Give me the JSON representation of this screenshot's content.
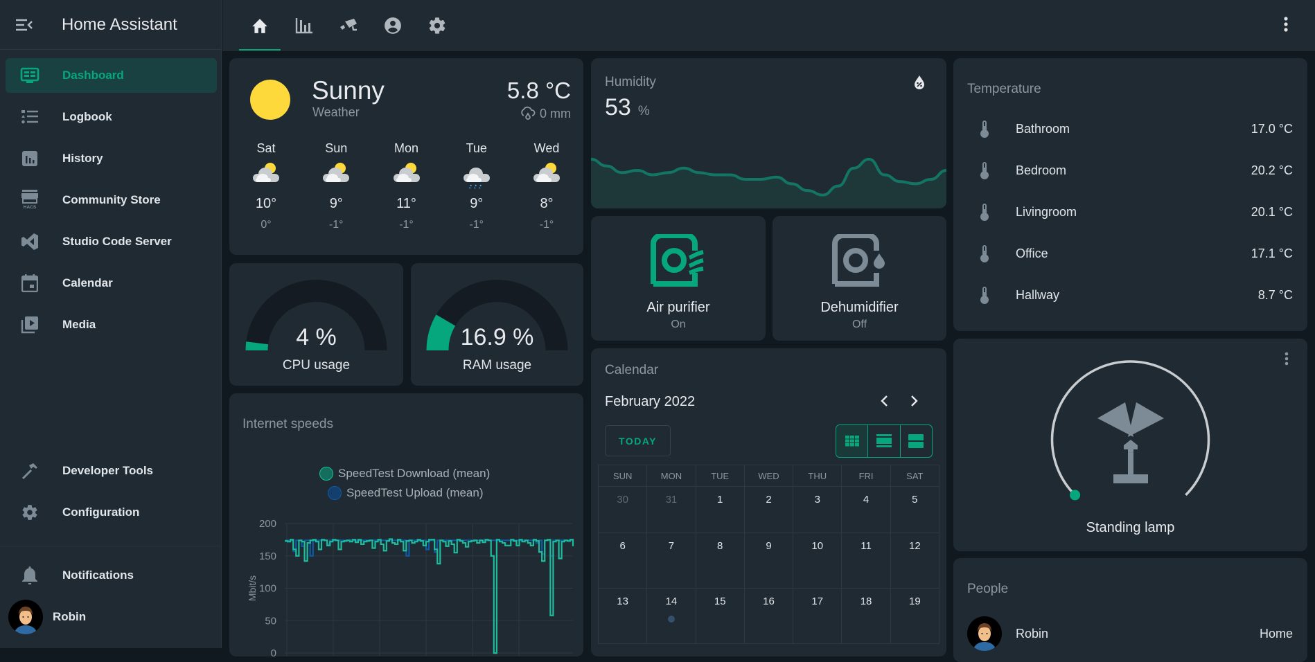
{
  "app": {
    "title": "Home Assistant"
  },
  "sidebar": {
    "items": [
      {
        "label": "Dashboard",
        "icon": "dashboard-icon",
        "active": true
      },
      {
        "label": "Logbook",
        "icon": "logbook-icon"
      },
      {
        "label": "History",
        "icon": "history-icon"
      },
      {
        "label": "Community Store",
        "icon": "hacs-icon"
      },
      {
        "label": "Studio Code Server",
        "icon": "vscode-icon"
      },
      {
        "label": "Calendar",
        "icon": "calendar-icon"
      },
      {
        "label": "Media",
        "icon": "media-icon"
      }
    ],
    "bottom": [
      {
        "label": "Developer Tools",
        "icon": "hammer-icon"
      },
      {
        "label": "Configuration",
        "icon": "gear-icon"
      }
    ],
    "notifications": "Notifications",
    "user": "Robin"
  },
  "topbar": {
    "tabs": [
      "home",
      "energy",
      "camera",
      "person",
      "settings"
    ],
    "active_tab": "home"
  },
  "weather": {
    "condition": "Sunny",
    "name": "Weather",
    "temperature": "5.8 °C",
    "precipitation": "0 mm",
    "forecast": [
      {
        "day": "Sat",
        "high": "10°",
        "low": "0°",
        "icon": "partly-cloudy"
      },
      {
        "day": "Sun",
        "high": "9°",
        "low": "-1°",
        "icon": "partly-cloudy"
      },
      {
        "day": "Mon",
        "high": "11°",
        "low": "-1°",
        "icon": "partly-cloudy"
      },
      {
        "day": "Tue",
        "high": "9°",
        "low": "-1°",
        "icon": "rainy"
      },
      {
        "day": "Wed",
        "high": "8°",
        "low": "-1°",
        "icon": "partly-cloudy"
      }
    ]
  },
  "gauges": [
    {
      "label": "CPU usage",
      "display": "4 %",
      "value": 4
    },
    {
      "label": "RAM usage",
      "display": "16.9 %",
      "value": 16.9
    }
  ],
  "humidity": {
    "title": "Humidity",
    "value": "53",
    "unit": "%",
    "history": [
      62,
      59,
      56,
      57,
      55,
      56,
      58,
      56,
      55,
      55,
      53,
      53,
      54,
      51,
      48,
      46,
      50,
      58,
      62,
      55,
      52,
      51,
      53,
      57
    ]
  },
  "devices": [
    {
      "name": "Air purifier",
      "state": "On",
      "color": "#06a77d"
    },
    {
      "name": "Dehumidifier",
      "state": "Off",
      "color": "#7c8b96"
    }
  ],
  "temperature": {
    "title": "Temperature",
    "rows": [
      {
        "name": "Bathroom",
        "value": "17.0 °C"
      },
      {
        "name": "Bedroom",
        "value": "20.2 °C"
      },
      {
        "name": "Livingroom",
        "value": "20.1 °C"
      },
      {
        "name": "Office",
        "value": "17.1 °C"
      },
      {
        "name": "Hallway",
        "value": "8.7 °C"
      }
    ]
  },
  "lamp": {
    "name": "Standing lamp",
    "brightness": 0
  },
  "calendar": {
    "title": "Calendar",
    "month": "February 2022",
    "today_label": "TODAY",
    "weekdays": [
      "SUN",
      "MON",
      "TUE",
      "WED",
      "THU",
      "FRI",
      "SAT"
    ],
    "weeks": [
      [
        "30",
        "31",
        "1",
        "2",
        "3",
        "4",
        "5"
      ],
      [
        "6",
        "7",
        "8",
        "9",
        "10",
        "11",
        "12"
      ],
      [
        "13",
        "14",
        "15",
        "16",
        "17",
        "18",
        "19"
      ]
    ],
    "outside_month": [
      "30",
      "31"
    ],
    "event_days": [
      "14"
    ]
  },
  "people": {
    "title": "People",
    "rows": [
      {
        "name": "Robin",
        "state": "Home"
      }
    ]
  },
  "chart_data": {
    "type": "line",
    "title": "Internet speeds",
    "ylabel": "Mbit/s",
    "ylim": [
      0,
      200
    ],
    "yticks": [
      0,
      50,
      100,
      150,
      200
    ],
    "legend": "top",
    "series": [
      {
        "name": "SpeedTest Download (mean)",
        "color": "#1cbc9c",
        "values": [
          173,
          172,
          175,
          160,
          150,
          174,
          172,
          142,
          170,
          174,
          175,
          172,
          160,
          175,
          174,
          166,
          172,
          175,
          174,
          160,
          172,
          173,
          174,
          172,
          175,
          171,
          175,
          168,
          172,
          173,
          174,
          162,
          172,
          175,
          168,
          158,
          173,
          176,
          170,
          168,
          175,
          172,
          158,
          173,
          174,
          170,
          172,
          175,
          173,
          166,
          172,
          175,
          175,
          160,
          138,
          174,
          172,
          165,
          173,
          168,
          155,
          175,
          173,
          170,
          164,
          172,
          173,
          174,
          170,
          174,
          171,
          175,
          174,
          150,
          0,
          175,
          172,
          170,
          166,
          166,
          175,
          173,
          166,
          175,
          172,
          174,
          170,
          166,
          175,
          173,
          156,
          142,
          174,
          175,
          58,
          172,
          174,
          146,
          172,
          174,
          173,
          175,
          165
        ]
      },
      {
        "name": "SpeedTest Upload (mean)",
        "color": "#0e5aa7",
        "values": [
          174,
          174,
          174,
          157,
          174,
          174,
          165,
          174,
          174,
          150,
          174,
          174,
          174,
          174,
          174,
          168,
          174,
          174,
          174,
          174,
          174,
          174,
          174,
          174,
          174,
          174,
          174,
          174,
          174,
          174,
          174,
          174,
          174,
          174,
          174,
          174,
          174,
          174,
          174,
          174,
          174,
          174,
          174,
          150,
          174,
          174,
          174,
          174,
          174,
          174,
          160,
          174,
          174,
          156,
          174,
          174,
          174,
          174,
          174,
          174,
          174,
          174,
          174,
          174,
          174,
          174,
          174,
          174,
          174,
          174,
          174,
          174,
          174,
          174,
          174,
          174,
          174,
          174,
          174,
          174,
          174,
          174,
          174,
          174,
          174,
          174,
          174,
          174,
          174,
          170,
          174,
          153,
          174,
          174,
          150,
          174,
          174,
          174,
          174,
          174,
          174,
          174,
          174
        ]
      }
    ]
  }
}
